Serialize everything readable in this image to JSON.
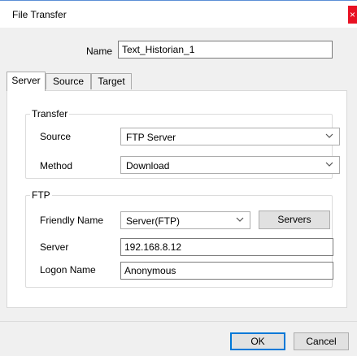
{
  "window": {
    "title": "File Transfer",
    "close_glyph": "×"
  },
  "name_field": {
    "label": "Name",
    "value": "Text_Historian_1"
  },
  "tabs": [
    {
      "label": "Server",
      "active": true
    },
    {
      "label": "Source",
      "active": false
    },
    {
      "label": "Target",
      "active": false
    }
  ],
  "transfer": {
    "title": "Transfer",
    "source_label": "Source",
    "source_value": "FTP Server",
    "method_label": "Method",
    "method_value": "Download"
  },
  "ftp": {
    "title": "FTP",
    "friendly_name_label": "Friendly Name",
    "friendly_name_value": "Server(FTP)",
    "servers_button": "Servers",
    "server_label": "Server",
    "server_value": "192.168.8.12",
    "logon_label": "Logon Name",
    "logon_value": "Anonymous"
  },
  "footer": {
    "ok_label": "OK",
    "cancel_label": "Cancel"
  },
  "icons": {
    "chevron": "chevron-down-icon"
  }
}
